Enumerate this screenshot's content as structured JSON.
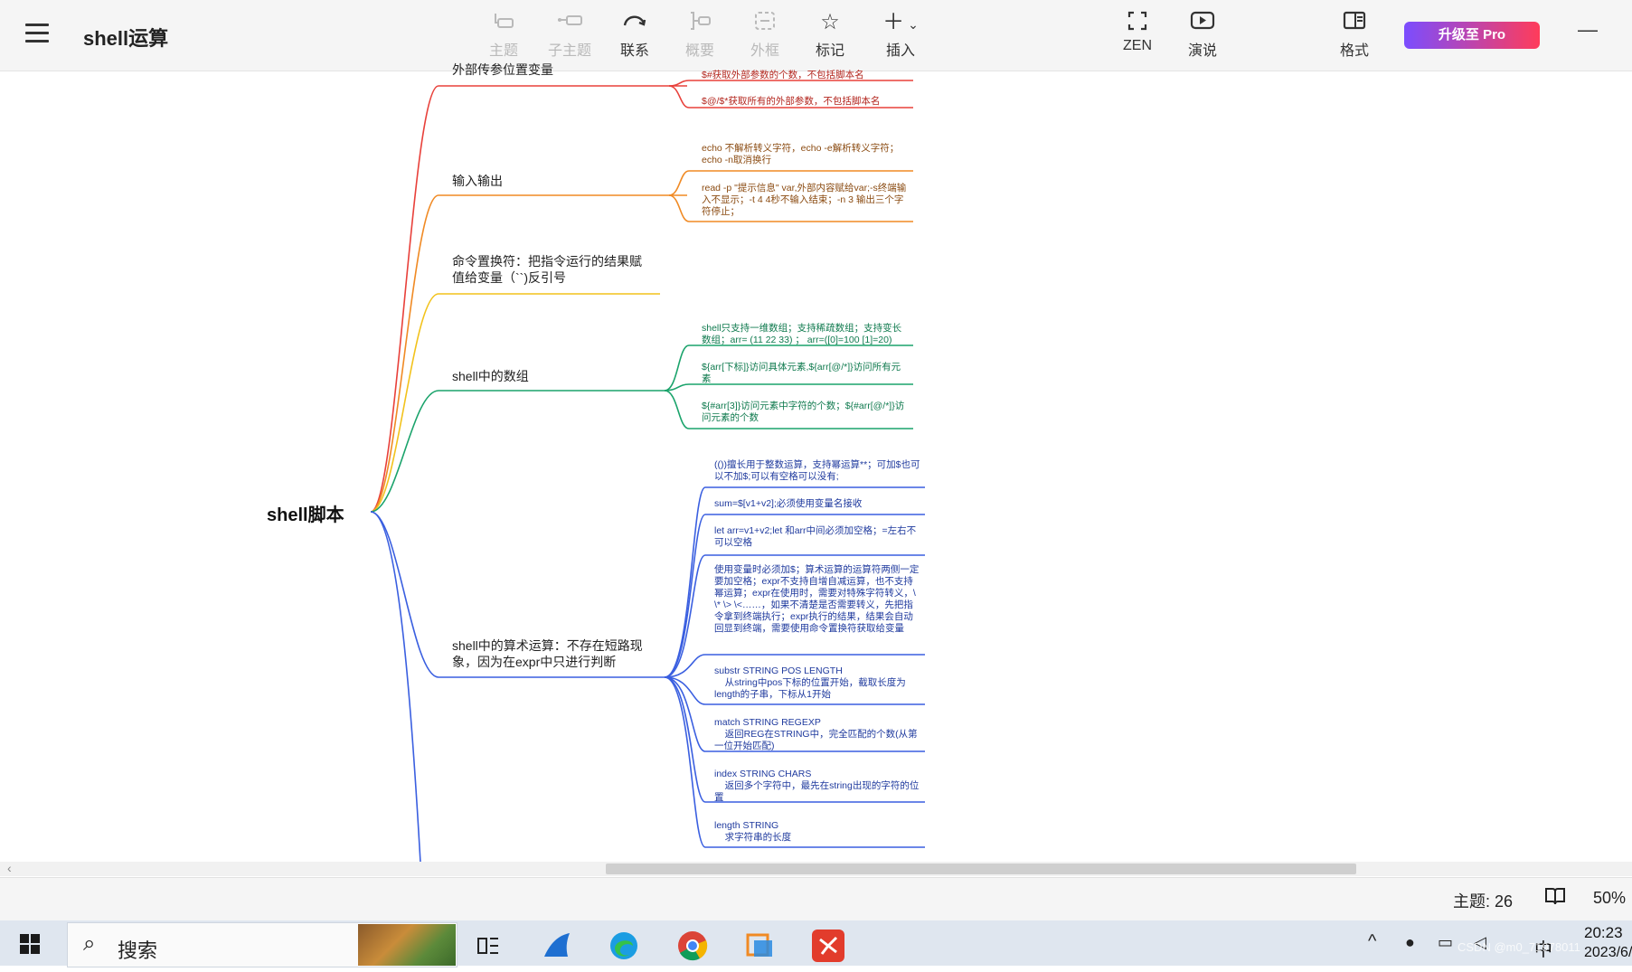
{
  "app": {
    "title": "shell运算"
  },
  "toolbar": {
    "items": [
      {
        "label": "主题",
        "icon": "topic-icon",
        "enabled": false
      },
      {
        "label": "子主题",
        "icon": "subtopic-icon",
        "enabled": false
      },
      {
        "label": "联系",
        "icon": "relationship-icon",
        "enabled": true
      },
      {
        "label": "概要",
        "icon": "summary-icon",
        "enabled": false
      },
      {
        "label": "外框",
        "icon": "boundary-icon",
        "enabled": false
      },
      {
        "label": "标记",
        "icon": "star-icon",
        "enabled": true
      },
      {
        "label": "插入",
        "icon": "plus-icon",
        "enabled": true
      },
      {
        "label": "ZEN",
        "icon": "fullscreen-icon",
        "enabled": true
      },
      {
        "label": "演说",
        "icon": "play-icon",
        "enabled": true
      },
      {
        "label": "格式",
        "icon": "format-panel-icon",
        "enabled": true
      }
    ],
    "upgrade_label": "升级至 Pro",
    "minimize_label": "—"
  },
  "mindmap": {
    "root": "shell脚本",
    "branches": [
      {
        "label": "外部传参位置变量",
        "color": "#e8403a",
        "leaves": [
          "$#获取外部参数的个数，不包括脚本名",
          "$@/$*获取所有的外部参数，不包括脚本名"
        ]
      },
      {
        "label": "输入输出",
        "color": "#f08a24",
        "leaves": [
          "echo 不解析转义字符，echo -e解析转义字符；echo -n取消换行",
          "read -p \"提示信息\" var,外部内容赋给var;-s终端输入不显示；-t 4 4秒不输入结束；-n 3 输出三个字符停止；"
        ]
      },
      {
        "label": "命令置换符：把指令运行的结果赋值给变量（``)反引号",
        "color": "#f2c21b",
        "leaves": []
      },
      {
        "label": "shell中的数组",
        "color": "#1aa36b",
        "leaves": [
          "shell只支持一维数组；支持稀疏数组；支持变长数组；arr= (11 22 33) ； arr=([0]=100 [1]=20)",
          "${arr[下标]}访问具体元素,${arr[@/*]}访问所有元素",
          "${#arr[3]}访问元素中字符的个数；${#arr[@/*]}访问元素的个数"
        ]
      },
      {
        "label": "shell中的算术运算：不存在短路现象，因为在expr中只进行判断",
        "color": "#3a5fe0",
        "leaves": [
          "(())擅长用于整数运算，支持幂运算**；可加$也可以不加$;可以有空格可以没有;",
          "sum=$[v1+v2];必须使用变量名接收",
          "let arr=v1+v2;let 和arr中间必须加空格；=左右不可以空格",
          "使用变量时必须加$；算术运算的运算符两侧一定要加空格；expr不支持自增自减运算，也不支持幂运算；expr在使用时，需要对特殊字符转义，\\ \\* \\> \\<……，如果不清楚是否需要转义，先把指令拿到终端执行；expr执行的结果，结果会自动回显到终端，需要使用命令置换符获取给变量",
          "substr STRING POS LENGTH\n    从string中pos下标的位置开始，截取长度为length的子串，下标从1开始",
          "match STRING REGEXP\n    返回REG在STRING中，完全匹配的个数(从第一位开始匹配)",
          "index STRING CHARS\n    返回多个字符中，最先在string出现的字符的位置",
          "length STRING\n    求字符串的长度"
        ]
      }
    ]
  },
  "status": {
    "topic_count": "主题: 26",
    "zoom": "50%"
  },
  "taskbar": {
    "search_label": "搜索",
    "time": "20:23",
    "date": "2023/6/",
    "lang": "中",
    "watermark": "CSDN @m0_71978011"
  }
}
